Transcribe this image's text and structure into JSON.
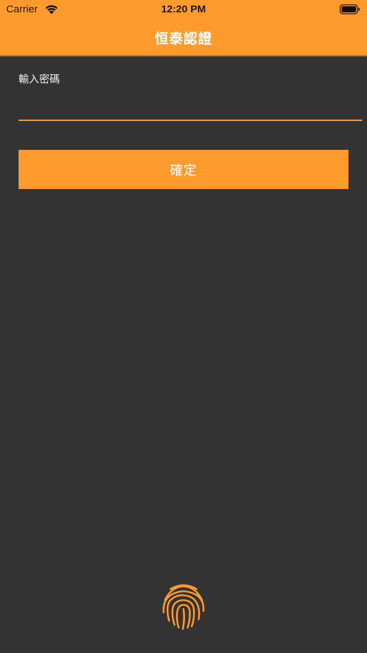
{
  "status_bar": {
    "carrier": "Carrier",
    "time": "12:20 PM",
    "icons": [
      "wifi-icon",
      "battery-icon"
    ]
  },
  "header": {
    "title": "恒泰認證"
  },
  "form": {
    "password_label": "輸入密碼",
    "password_value": "",
    "confirm_label": "確定"
  },
  "fingerprint": {
    "icon": "fingerprint-icon"
  },
  "colors": {
    "accent": "#FF9A2C",
    "background": "#333333",
    "text": "#FFFFFF"
  }
}
